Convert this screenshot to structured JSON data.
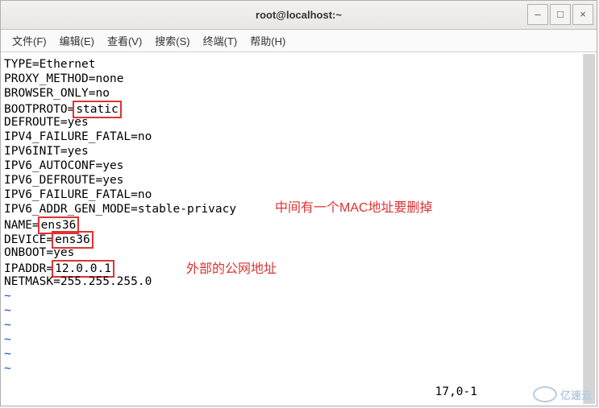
{
  "window": {
    "title": "root@localhost:~"
  },
  "menu": {
    "file": "文件(F)",
    "edit": "编辑(E)",
    "view": "查看(V)",
    "search": "搜索(S)",
    "terminal": "终端(T)",
    "help": "帮助(H)"
  },
  "config": {
    "lines": [
      {
        "key": "TYPE",
        "value": "Ethernet",
        "boxed": false
      },
      {
        "key": "PROXY_METHOD",
        "value": "none",
        "boxed": false
      },
      {
        "key": "BROWSER_ONLY",
        "value": "no",
        "boxed": false
      },
      {
        "key": "BOOTPROTO",
        "value": "static",
        "boxed": true
      },
      {
        "key": "DEFROUTE",
        "value": "yes",
        "boxed": false
      },
      {
        "key": "IPV4_FAILURE_FATAL",
        "value": "no",
        "boxed": false
      },
      {
        "key": "IPV6INIT",
        "value": "yes",
        "boxed": false
      },
      {
        "key": "IPV6_AUTOCONF",
        "value": "yes",
        "boxed": false
      },
      {
        "key": "IPV6_DEFROUTE",
        "value": "yes",
        "boxed": false
      },
      {
        "key": "IPV6_FAILURE_FATAL",
        "value": "no",
        "boxed": false
      },
      {
        "key": "IPV6_ADDR_GEN_MODE",
        "value": "stable-privacy",
        "boxed": false
      },
      {
        "key": "NAME",
        "value": "ens36",
        "boxed": true
      },
      {
        "key": "DEVICE",
        "value": "ens36",
        "boxed": true
      },
      {
        "key": "ONBOOT",
        "value": "yes",
        "boxed": false
      },
      {
        "key": "IPADDR",
        "value": "12.0.0.1",
        "boxed": true
      },
      {
        "key": "NETMASK",
        "value": "255.255.255.0",
        "boxed": false
      }
    ]
  },
  "tilde": "~",
  "annotations": {
    "mac_note": "中间有一个MAC地址要删掉",
    "ip_note": "外部的公网地址"
  },
  "status": {
    "position": "17,0-1"
  },
  "watermark": {
    "text": "亿速云"
  },
  "controls": {
    "minimize": "–",
    "maximize": "□",
    "close": "×"
  }
}
